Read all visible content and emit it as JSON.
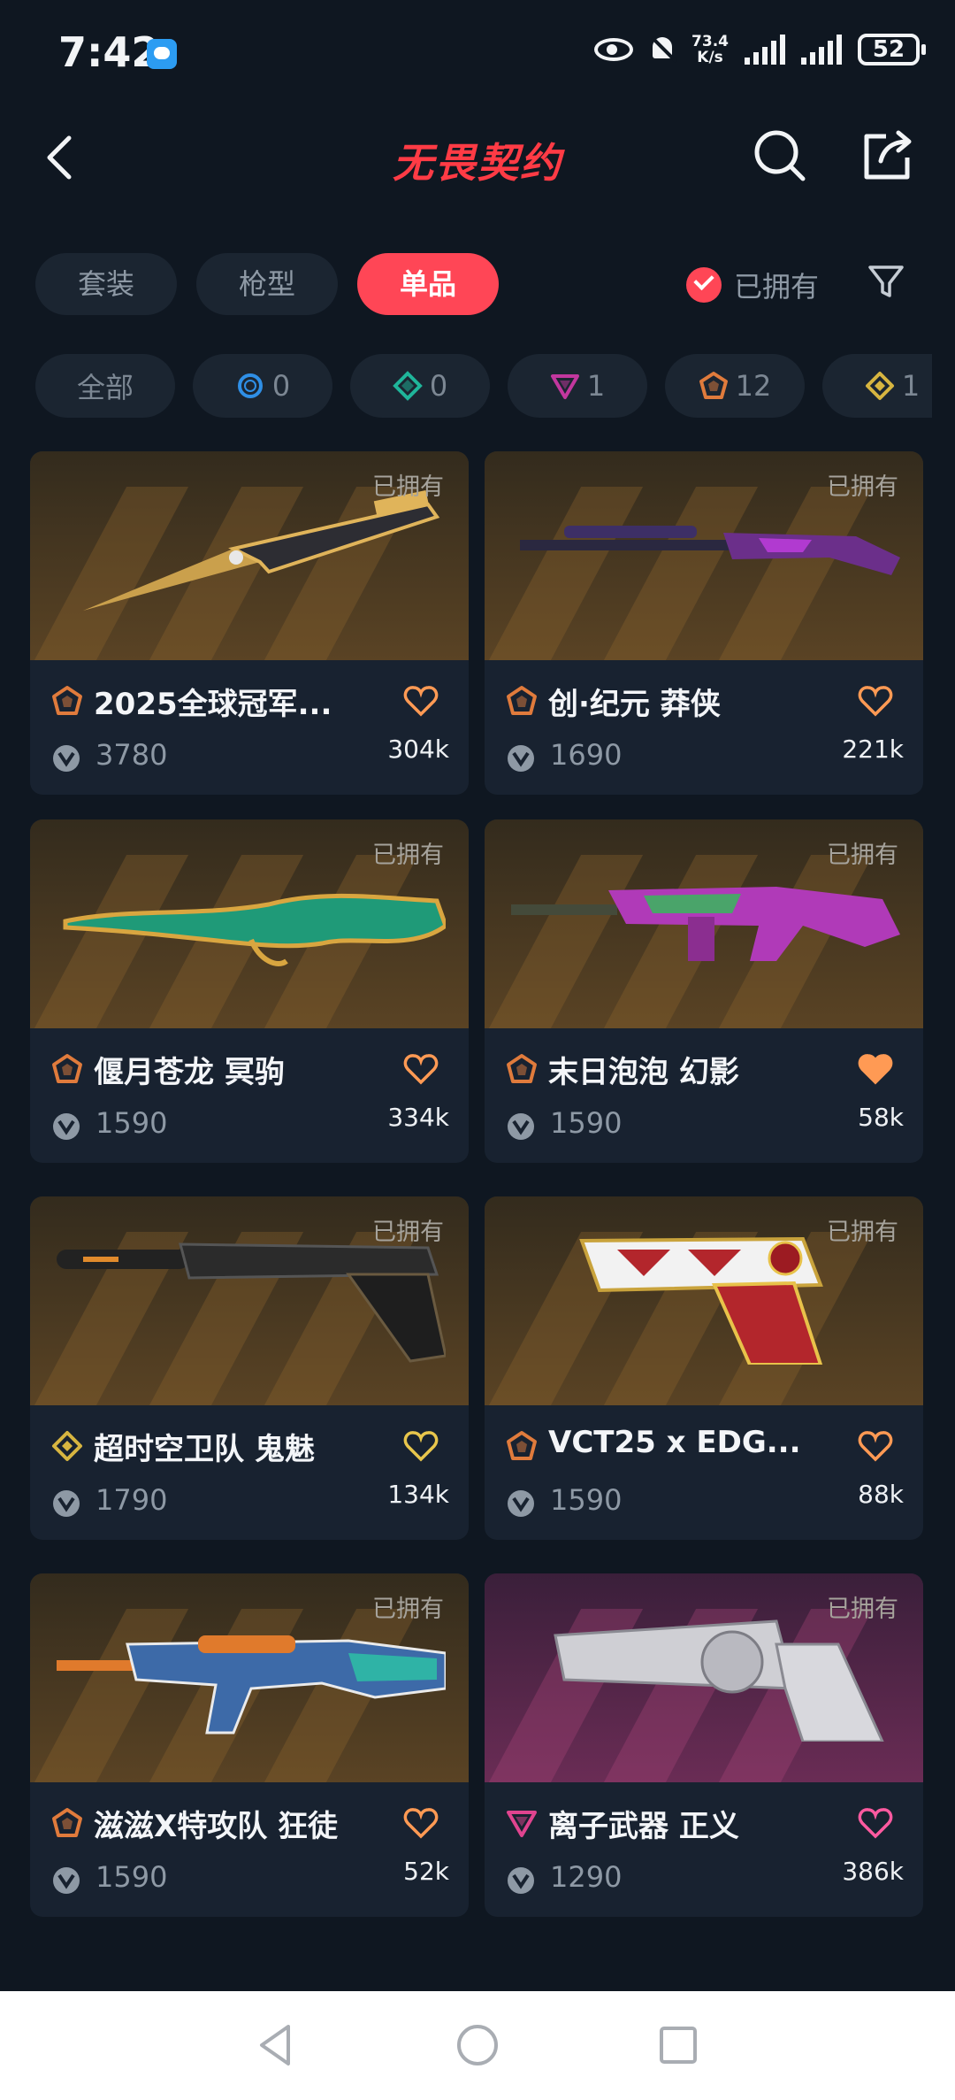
{
  "status": {
    "time": "7:42",
    "net_speed": "73.4",
    "net_unit": "K/s",
    "battery": "52"
  },
  "header": {
    "title": "无畏契约"
  },
  "tabs": [
    {
      "label": "套装",
      "active": false
    },
    {
      "label": "枪型",
      "active": false
    },
    {
      "label": "单品",
      "active": true
    }
  ],
  "filter": {
    "owned_label": "已拥有"
  },
  "chips": [
    {
      "label": "全部",
      "icon": "none"
    },
    {
      "label": "0",
      "icon": "select-tier-icon",
      "color": "#2f8fe6"
    },
    {
      "label": "0",
      "icon": "deluxe-tier-icon",
      "color": "#1fb59a"
    },
    {
      "label": "1",
      "icon": "premium-tier-icon",
      "color": "#c2379e"
    },
    {
      "label": "12",
      "icon": "ultra-tier-icon",
      "color": "#e07b3c"
    },
    {
      "label": "1",
      "icon": "exclusive-tier-icon",
      "color": "#d7b540"
    }
  ],
  "cards": [
    {
      "name": "2025全球冠军...",
      "owned": "已拥有",
      "price": "3780",
      "likes": "304k",
      "tier_color": "#e07b3c",
      "heart_color": "#ff9a54",
      "liked": false,
      "theme": "gold"
    },
    {
      "name": "创·纪元 莽侠",
      "owned": "已拥有",
      "price": "1690",
      "likes": "221k",
      "tier_color": "#e07b3c",
      "heart_color": "#ff9a54",
      "liked": false,
      "theme": "gold"
    },
    {
      "name": "偃月苍龙 冥驹",
      "owned": "已拥有",
      "price": "1590",
      "likes": "334k",
      "tier_color": "#e07b3c",
      "heart_color": "#ff9a54",
      "liked": false,
      "theme": "gold"
    },
    {
      "name": "末日泡泡 幻影",
      "owned": "已拥有",
      "price": "1590",
      "likes": "58k",
      "tier_color": "#e07b3c",
      "heart_color": "#ff9a54",
      "liked": true,
      "theme": "gold"
    },
    {
      "name": "超时空卫队 鬼魅",
      "owned": "已拥有",
      "price": "1790",
      "likes": "134k",
      "tier_color": "#d7b540",
      "heart_color": "#e8c64c",
      "liked": false,
      "theme": "gold"
    },
    {
      "name": "VCT25 x EDG...",
      "owned": "已拥有",
      "price": "1590",
      "likes": "88k",
      "tier_color": "#e07b3c",
      "heart_color": "#ff9a54",
      "liked": false,
      "theme": "gold"
    },
    {
      "name": "滋滋X特攻队 狂徒",
      "owned": "已拥有",
      "price": "1590",
      "likes": "52k",
      "tier_color": "#e07b3c",
      "heart_color": "#ff9a54",
      "liked": false,
      "theme": "gold"
    },
    {
      "name": "离子武器 正义",
      "owned": "已拥有",
      "price": "1290",
      "likes": "386k",
      "tier_color": "#e0448f",
      "heart_color": "#ff5aa0",
      "liked": false,
      "theme": "purple"
    }
  ]
}
